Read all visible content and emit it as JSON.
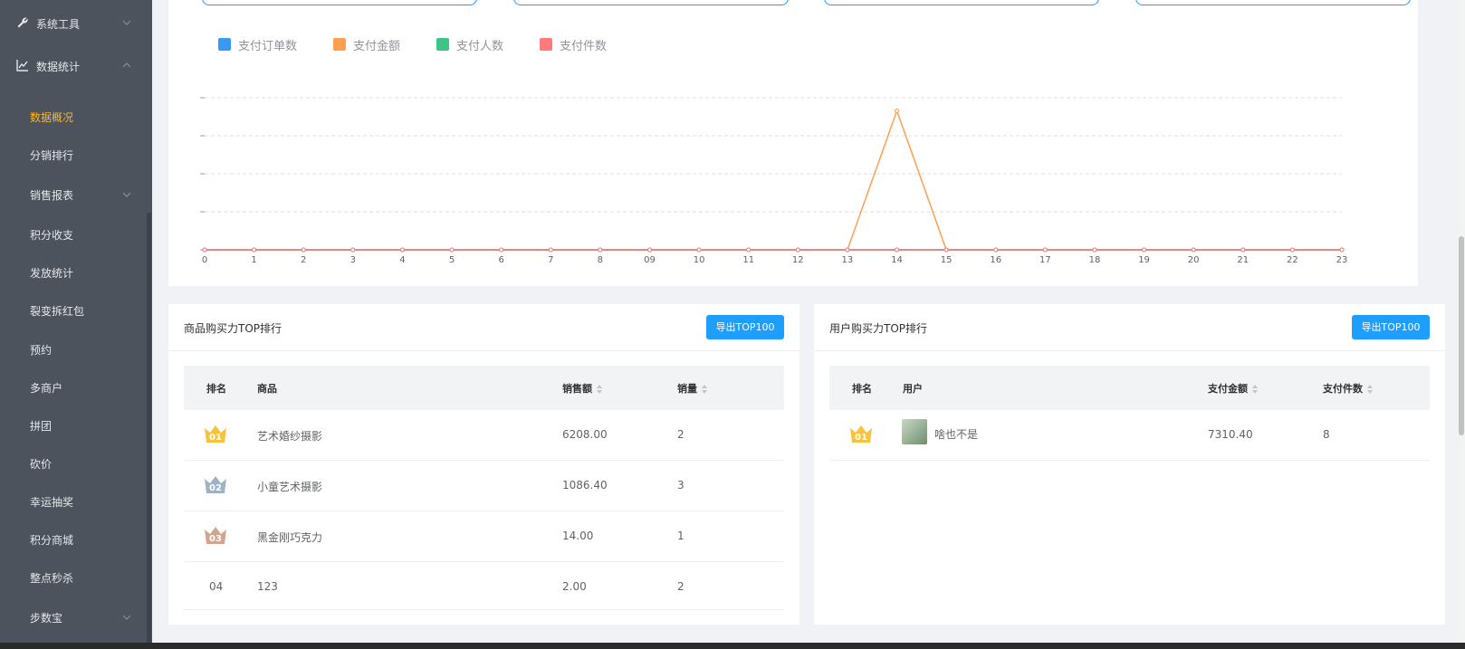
{
  "sidebar": {
    "groups": [
      {
        "label": "系统工具",
        "icon": "wrench-icon"
      },
      {
        "label": "数据统计",
        "icon": "line-chart-icon"
      }
    ],
    "items": [
      {
        "label": "数据概况"
      },
      {
        "label": "分销排行"
      },
      {
        "label": "销售报表"
      },
      {
        "label": "积分收支"
      },
      {
        "label": "发放统计"
      },
      {
        "label": "裂变拆红包"
      },
      {
        "label": "预约"
      },
      {
        "label": "多商户"
      },
      {
        "label": "拼团"
      },
      {
        "label": "砍价"
      },
      {
        "label": "幸运抽奖"
      },
      {
        "label": "积分商城"
      },
      {
        "label": "整点秒杀"
      },
      {
        "label": "步数宝"
      }
    ],
    "active": "数据概况",
    "accent_color": "#f7b733"
  },
  "chart_data": {
    "type": "line",
    "x": [
      "0",
      "1",
      "2",
      "3",
      "4",
      "5",
      "6",
      "7",
      "8",
      "09",
      "10",
      "11",
      "12",
      "13",
      "14",
      "15",
      "16",
      "17",
      "18",
      "19",
      "20",
      "21",
      "22",
      "23"
    ],
    "series": [
      {
        "name": "支付订单数",
        "color": "#3a98f8",
        "values": [
          0,
          0,
          0,
          0,
          0,
          0,
          0,
          0,
          0,
          0.01,
          0,
          0,
          0.01,
          0,
          0.01,
          0,
          0,
          0,
          0,
          0,
          0,
          0,
          0,
          0
        ]
      },
      {
        "name": "支付金额",
        "color": "#ff9f4f",
        "values": [
          0,
          0,
          0,
          0,
          0,
          0,
          0,
          0,
          0,
          0,
          0,
          0,
          0,
          0,
          7310.4,
          0,
          0,
          0,
          0,
          0,
          0,
          0,
          0,
          0
        ]
      },
      {
        "name": "支付人数",
        "color": "#3cc585",
        "values": [
          0,
          0,
          0,
          0,
          0,
          0,
          0,
          0,
          0,
          0.01,
          0,
          0,
          0.01,
          0,
          0.01,
          0,
          0,
          0,
          0,
          0,
          0,
          0,
          0,
          0
        ]
      },
      {
        "name": "支付件数",
        "color": "#ff7a7a",
        "values": [
          0,
          0,
          0,
          0,
          0,
          0,
          0,
          0,
          0,
          0.02,
          0,
          0,
          0.02,
          0,
          0.02,
          0,
          0,
          0,
          0,
          0,
          0,
          0,
          0,
          0
        ]
      }
    ],
    "ylim": [
      0,
      8000
    ],
    "grid": true,
    "legend": "top-left"
  },
  "goods_rank": {
    "title": "商品购买力TOP排行",
    "export_label": "导出TOP100",
    "headers": [
      "排名",
      "商品",
      "销售额",
      "销量"
    ],
    "rows": [
      {
        "rank": "01",
        "name": "艺术婚纱摄影",
        "amount": "6208.00",
        "count": "2"
      },
      {
        "rank": "02",
        "name": "小童艺术摄影",
        "amount": "1086.40",
        "count": "3"
      },
      {
        "rank": "03",
        "name": "黑金刚巧克力",
        "amount": "14.00",
        "count": "1"
      },
      {
        "rank": "04",
        "name": "123",
        "amount": "2.00",
        "count": "2"
      }
    ]
  },
  "user_rank": {
    "title": "用户购买力TOP排行",
    "export_label": "导出TOP100",
    "headers": [
      "排名",
      "用户",
      "支付金额",
      "支付件数"
    ],
    "rows": [
      {
        "rank": "01",
        "name": "啥也不是",
        "amount": "7310.40",
        "count": "8"
      }
    ]
  }
}
